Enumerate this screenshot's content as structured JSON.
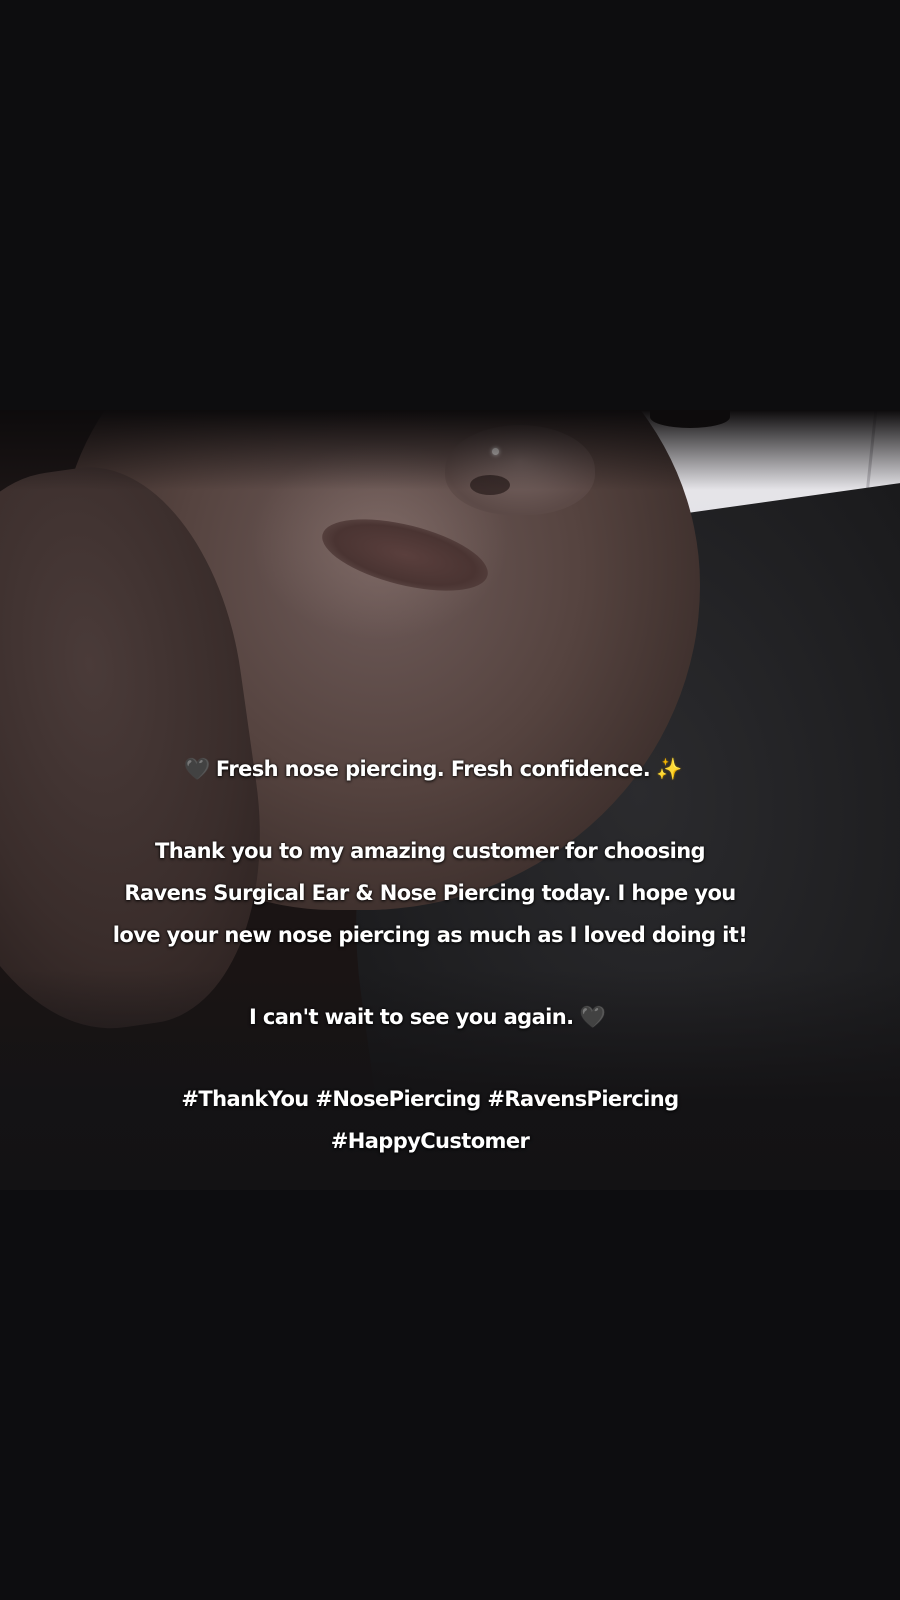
{
  "caption": {
    "heart_icon": "🖤",
    "sparkle_icon": "✨",
    "line1": "Fresh nose piercing. Fresh confidence.",
    "line2": "Thank you to my amazing customer for choosing",
    "line3": "Ravens Surgical Ear & Nose Piercing today. I hope you",
    "line4": "love your new nose piercing as much as I loved doing it!",
    "line5": "I can't wait to see you again.",
    "hashtags_line1": "#ThankYou #NosePiercing #RavensPiercing",
    "hashtags_line2": "#HappyCustomer"
  },
  "colors": {
    "background": "#0c0c0e",
    "text": "#ffffff",
    "sweater": "#1a1a1c",
    "wall": "#e9e8ec"
  },
  "icons": [
    "black-heart-icon",
    "sparkles-icon"
  ]
}
